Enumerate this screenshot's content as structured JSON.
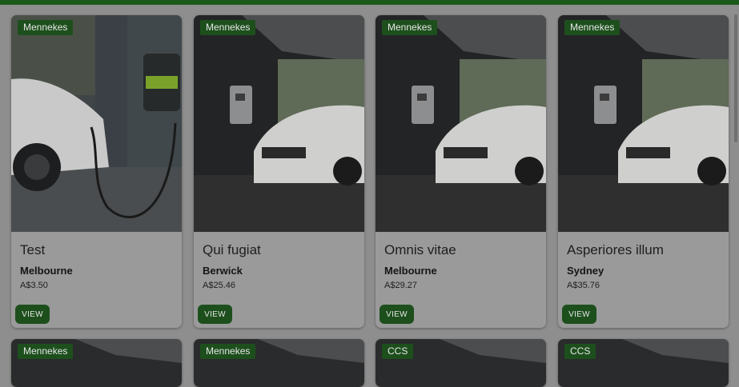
{
  "listings": [
    {
      "connector": "Mennekes",
      "title": "Test",
      "city": "Melbourne",
      "price": "A$3.50",
      "image": "tesla-charging-photo"
    },
    {
      "connector": "Mennekes",
      "title": "Qui fugiat",
      "city": "Berwick",
      "price": "A$25.46",
      "image": "garage-charger-photo"
    },
    {
      "connector": "Mennekes",
      "title": "Omnis vitae",
      "city": "Melbourne",
      "price": "A$29.27",
      "image": "garage-charger-photo"
    },
    {
      "connector": "Mennekes",
      "title": "Asperiores illum",
      "city": "Sydney",
      "price": "A$35.76",
      "image": "garage-charger-photo"
    }
  ],
  "listings_row2": [
    {
      "connector": "Mennekes",
      "image": "garage-charger-photo"
    },
    {
      "connector": "Mennekes",
      "image": "garage-charger-photo"
    },
    {
      "connector": "CCS",
      "image": "garage-charger-photo"
    },
    {
      "connector": "CCS",
      "image": "garage-charger-photo"
    }
  ],
  "view_label": "VIEW",
  "colors": {
    "accent": "#1d4f1d",
    "topbar": "#1c5a1c",
    "overlay_bg": "#8e8e8e"
  }
}
